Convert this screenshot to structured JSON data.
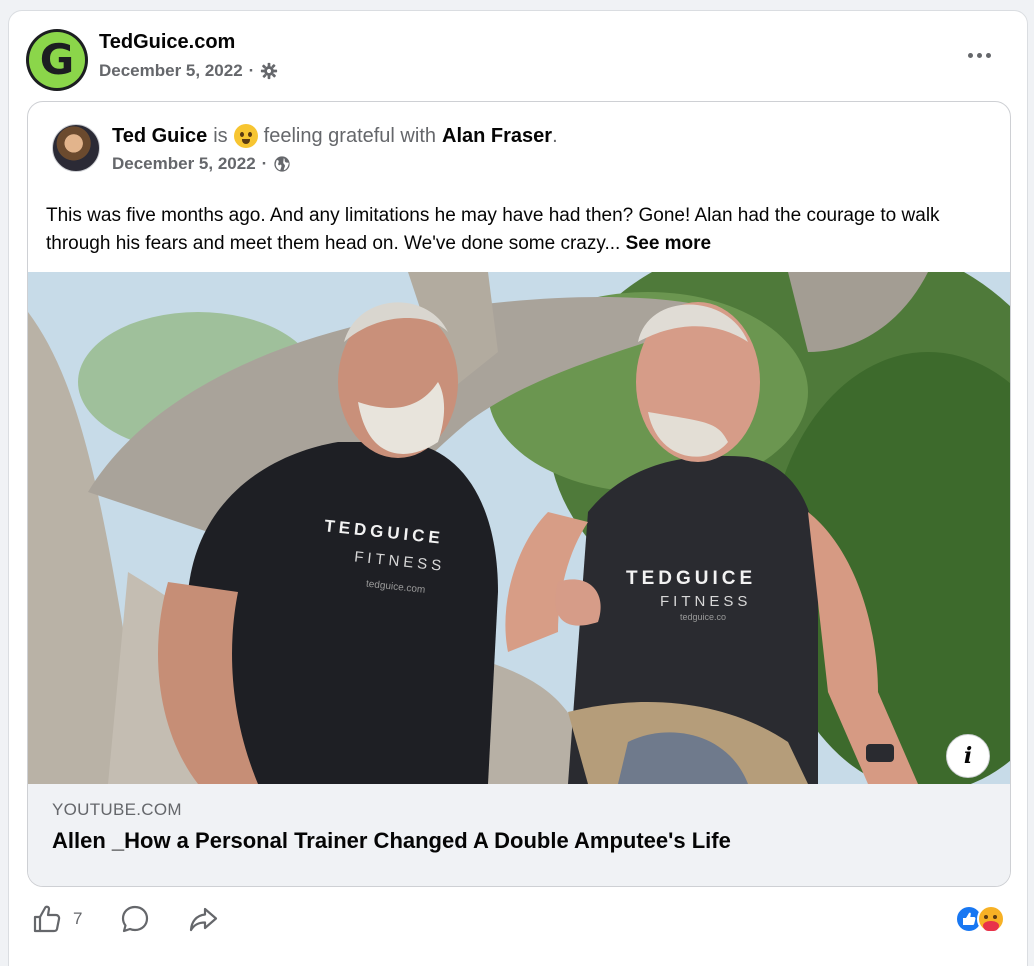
{
  "page": {
    "name": "TedGuice.com",
    "avatar_letter": "G",
    "date": "December 5, 2022",
    "separator": "·"
  },
  "shared_post": {
    "author": "Ted Guice",
    "is_word": "is",
    "feeling": "feeling grateful with",
    "tagged": "Alan Fraser",
    "period": ".",
    "date": "December 5, 2022",
    "separator": "·",
    "text": "This was five months ago. And any limitations he may have had then?  Gone!  Alan had the courage to walk through his fears and meet them head on.  We've done some crazy...",
    "see_more": "See more"
  },
  "media": {
    "shirt_left_line1": "TEDGUICE",
    "shirt_left_line2": "FITNESS",
    "shirt_left_line3": "tedguice.com",
    "shirt_right_line1": "TEDGUICE",
    "shirt_right_line2": "FITNESS",
    "shirt_right_line3": "tedguice.co",
    "info_glyph": "i"
  },
  "link": {
    "domain": "YOUTUBE.COM",
    "title": "Allen _How a Personal Trainer Changed A Double Amputee's Life"
  },
  "actions": {
    "like_count": "7"
  },
  "colors": {
    "brand_green": "#8bd64a",
    "like_blue": "#1877f2",
    "meta_gray": "#65676b"
  },
  "icons": {
    "gear": "gear-icon",
    "globe": "globe-icon",
    "like": "thumbs-up-icon",
    "comment": "comment-bubble-icon",
    "share": "share-arrow-icon",
    "more": "more-dots-icon"
  }
}
